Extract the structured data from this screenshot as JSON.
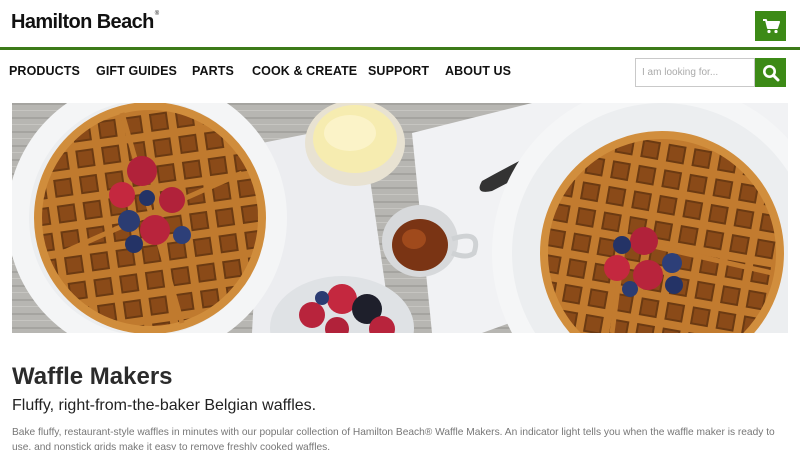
{
  "brand": {
    "name": "Hamilton Beach",
    "mark": "®"
  },
  "nav": {
    "items": [
      {
        "label": "PRODUCTS"
      },
      {
        "label": "GIFT GUIDES"
      },
      {
        "label": "PARTS"
      },
      {
        "label": "COOK & CREATE"
      },
      {
        "label": "SUPPORT"
      },
      {
        "label": "ABOUT US"
      }
    ]
  },
  "search": {
    "placeholder": "I am looking for..."
  },
  "icons": {
    "cart": "shopping-cart-icon",
    "search": "magnifier-icon"
  },
  "colors": {
    "accent": "#3c8a16",
    "rule": "#3c7a18"
  },
  "page": {
    "title": "Waffle Makers",
    "subtitle": "Fluffy, right-from-the-baker Belgian waffles.",
    "description": "Bake fluffy, restaurant-style waffles in minutes with our popular collection of Hamilton Beach® Waffle Makers. An indicator light tells you when the waffle maker is ready to use, and nonstick grids make it easy to remove freshly cooked waffles."
  }
}
